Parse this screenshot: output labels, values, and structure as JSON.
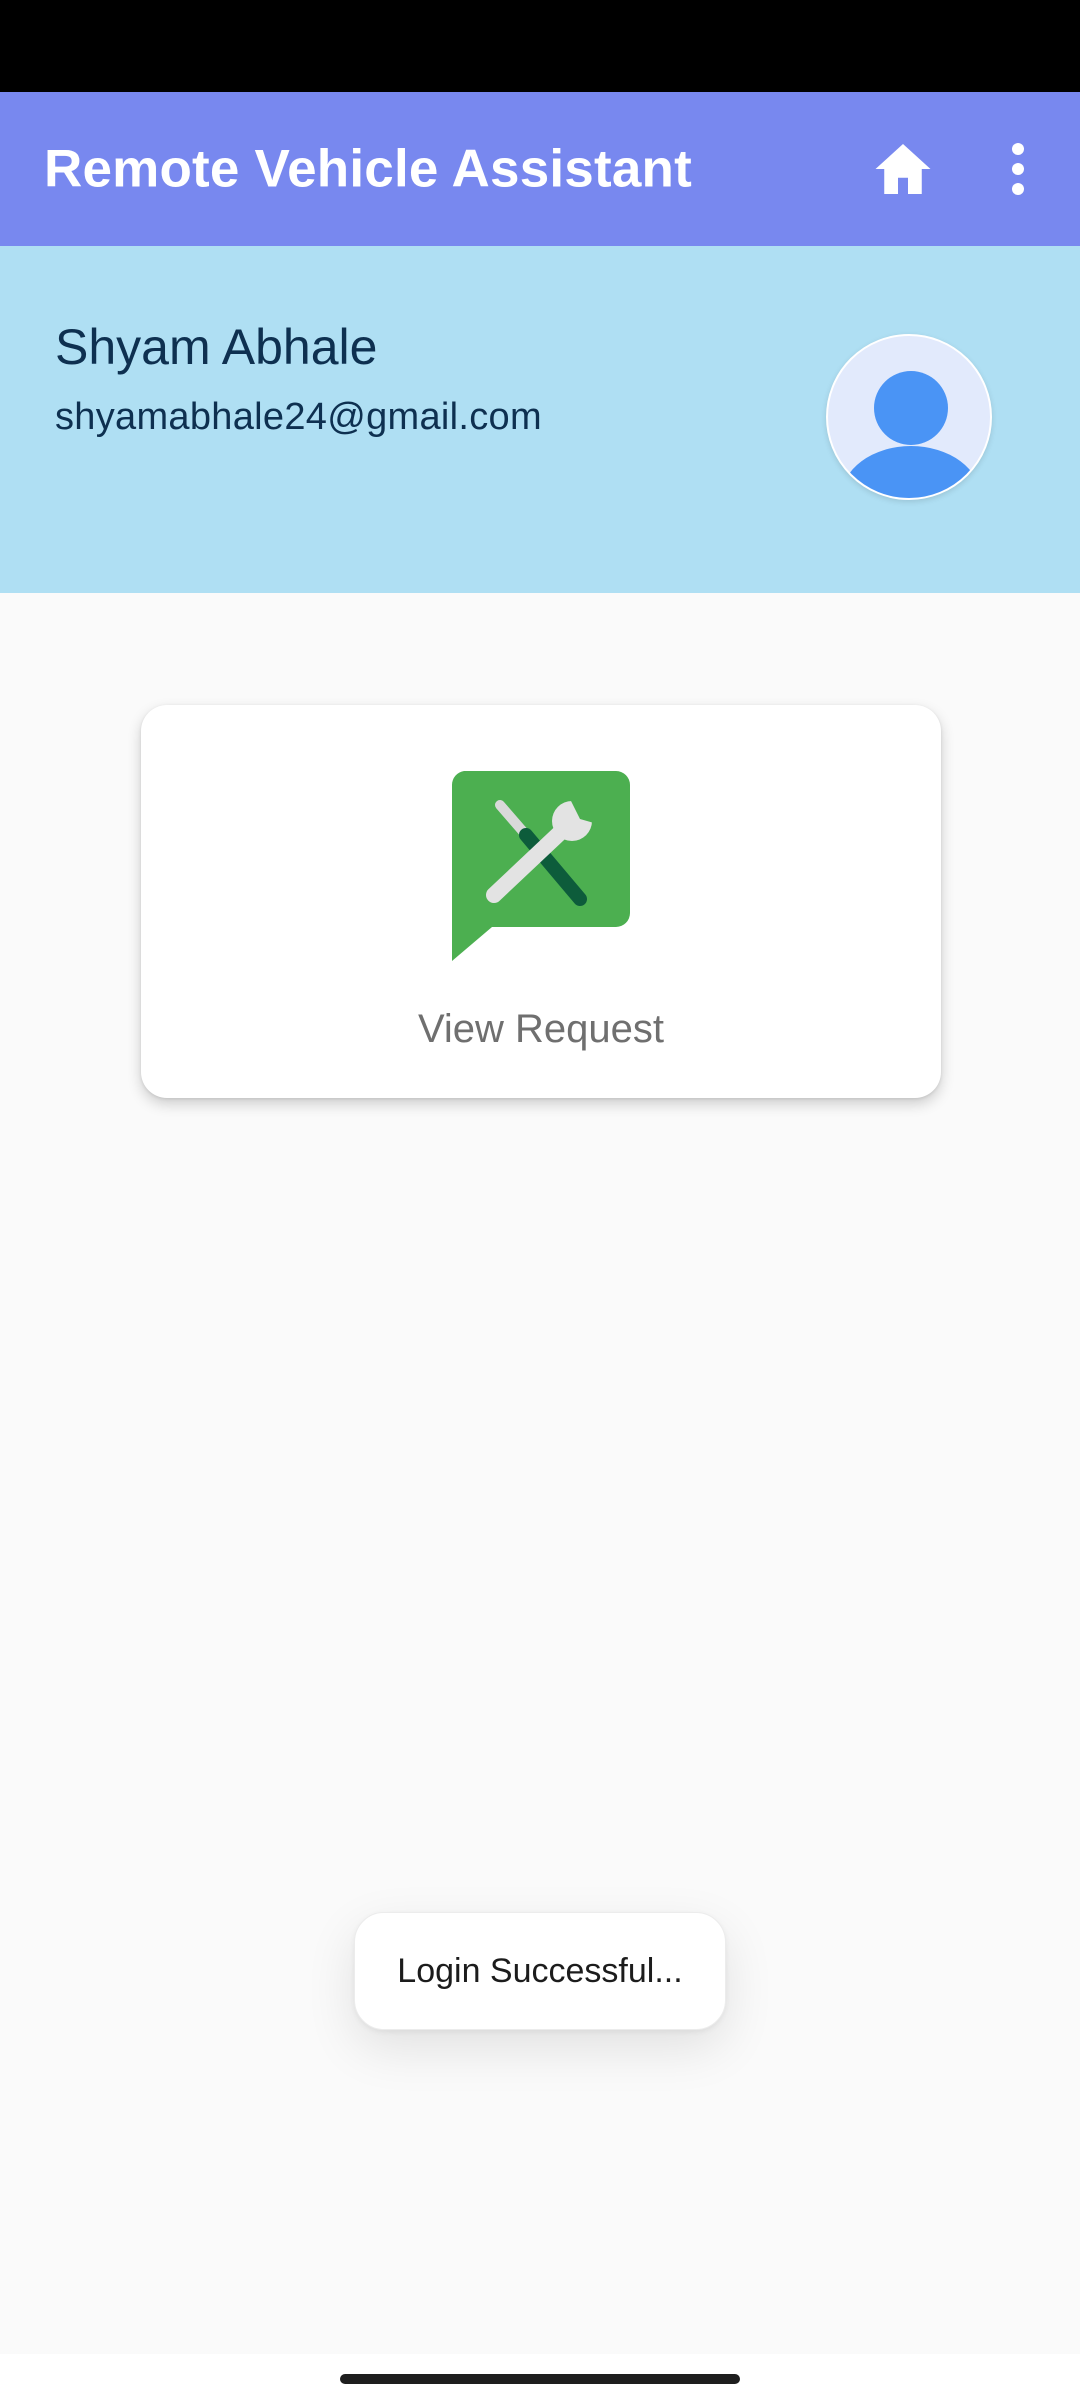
{
  "app_bar": {
    "title": "Remote Vehicle Assistant",
    "icons": [
      "home-icon",
      "more-vert-icon"
    ]
  },
  "profile": {
    "name": "Shyam Abhale",
    "email": "shyamabhale24@gmail.com",
    "avatar_icon": "person-icon"
  },
  "card": {
    "label": "View Request",
    "icon": "repair-tools-message-icon"
  },
  "toast": {
    "message": "Login Successful..."
  },
  "colors": {
    "app_bar": "#7888ef",
    "profile_header": "#afdff3",
    "card_icon_green": "#4caf50",
    "avatar_blue": "#4a94f5"
  }
}
